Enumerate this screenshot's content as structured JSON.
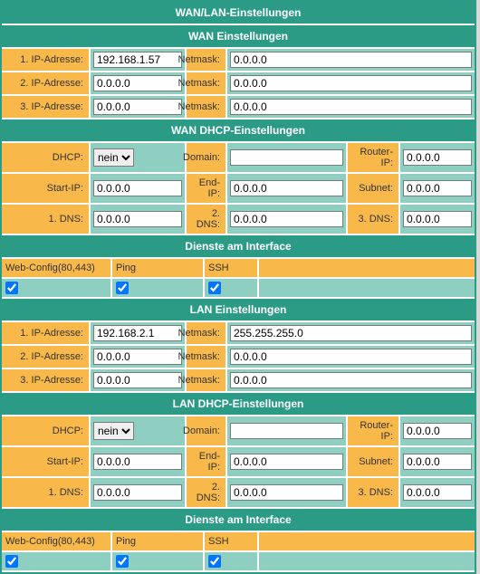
{
  "main_title": "WAN/LAN-Einstellungen",
  "wan": {
    "title": "WAN Einstellungen",
    "rows": [
      {
        "label": "1. IP-Adresse:",
        "value": "192.168.1.57",
        "mask_label": "Netmask:",
        "mask": "0.0.0.0"
      },
      {
        "label": "2. IP-Adresse:",
        "value": "0.0.0.0",
        "mask_label": "Netmask:",
        "mask": "0.0.0.0"
      },
      {
        "label": "3. IP-Adresse:",
        "value": "0.0.0.0",
        "mask_label": "Netmask:",
        "mask": "0.0.0.0"
      }
    ]
  },
  "wan_dhcp": {
    "title": "WAN DHCP-Einstellungen",
    "rows": [
      {
        "l1": "DHCP:",
        "v1_select": "nein",
        "l2": "Domain:",
        "v2": "",
        "l3": "Router-IP:",
        "v3": "0.0.0.0"
      },
      {
        "l1": "Start-IP:",
        "v1": "0.0.0.0",
        "l2": "End-IP:",
        "v2": "0.0.0.0",
        "l3": "Subnet:",
        "v3": "0.0.0.0"
      },
      {
        "l1": "1. DNS:",
        "v1": "0.0.0.0",
        "l2": "2. DNS:",
        "v2": "0.0.0.0",
        "l3": "3. DNS:",
        "v3": "0.0.0.0"
      }
    ]
  },
  "services": {
    "title": "Dienste am Interface",
    "headers": {
      "webconfig": "Web-Config(80,443)",
      "ping": "Ping",
      "ssh": "SSH"
    },
    "wan_values": {
      "webconfig": true,
      "ping": true,
      "ssh": true
    },
    "lan_values": {
      "webconfig": true,
      "ping": true,
      "ssh": true
    }
  },
  "lan": {
    "title": "LAN Einstellungen",
    "rows": [
      {
        "label": "1. IP-Adresse:",
        "value": "192.168.2.1",
        "mask_label": "Netmask:",
        "mask": "255.255.255.0"
      },
      {
        "label": "2. IP-Adresse:",
        "value": "0.0.0.0",
        "mask_label": "Netmask:",
        "mask": "0.0.0.0"
      },
      {
        "label": "3. IP-Adresse:",
        "value": "0.0.0.0",
        "mask_label": "Netmask:",
        "mask": "0.0.0.0"
      }
    ]
  },
  "lan_dhcp": {
    "title": "LAN DHCP-Einstellungen",
    "rows": [
      {
        "l1": "DHCP:",
        "v1_select": "nein",
        "l2": "Domain:",
        "v2": "",
        "l3": "Router-IP:",
        "v3": "0.0.0.0"
      },
      {
        "l1": "Start-IP:",
        "v1": "0.0.0.0",
        "l2": "End-IP:",
        "v2": "0.0.0.0",
        "l3": "Subnet:",
        "v3": "0.0.0.0"
      },
      {
        "l1": "1. DNS:",
        "v1": "0.0.0.0",
        "l2": "2. DNS:",
        "v2": "0.0.0.0",
        "l3": "3. DNS:",
        "v3": "0.0.0.0"
      }
    ]
  }
}
